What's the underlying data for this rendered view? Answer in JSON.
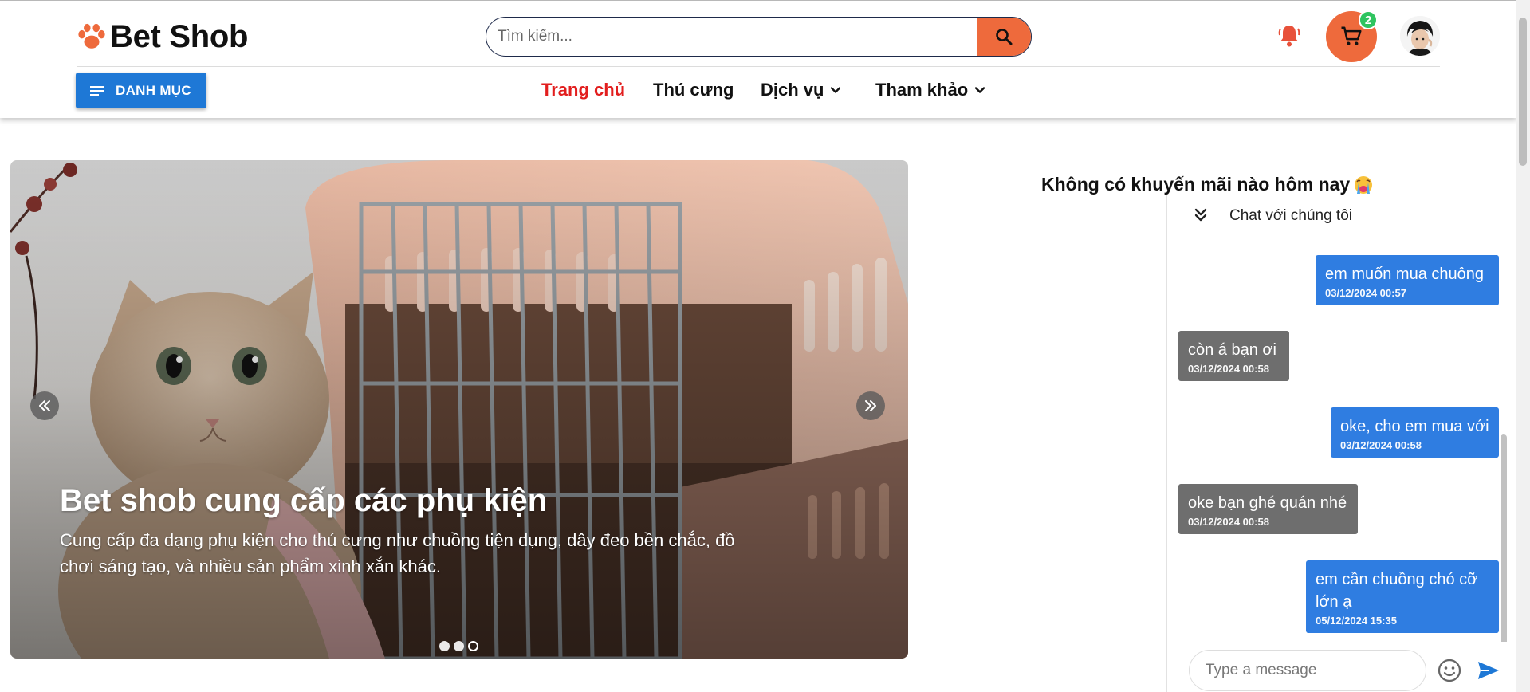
{
  "header": {
    "brand": "Bet Shob",
    "search_placeholder": "Tìm kiếm...",
    "cart_count": "2",
    "category_button": "DANH MỤC",
    "nav": [
      {
        "label": "Trang chủ",
        "active": true
      },
      {
        "label": "Thú cưng"
      },
      {
        "label": "Dịch vụ",
        "has_dropdown": true
      },
      {
        "label": "Tham khảo",
        "has_dropdown": true
      }
    ]
  },
  "carousel": {
    "title": "Bet shob cung cấp các phụ kiện",
    "description": "Cung cấp đa dạng phụ kiện cho thú cưng như chuồng tiện dụng, dây đeo bền chắc, đồ chơi sáng tạo, và nhiều sản phẩm xinh xắn khác.",
    "slide_count": 3,
    "active_slide": 3
  },
  "promo": {
    "text": "Không có khuyến mãi nào hôm nay"
  },
  "chat": {
    "title": "Chat với chúng tôi",
    "input_placeholder": "Type a message",
    "messages": [
      {
        "from": "me",
        "text": "em muốn mua chuông",
        "time": "03/12/2024 00:57"
      },
      {
        "from": "them",
        "text": "còn á bạn ơi",
        "time": "03/12/2024 00:58"
      },
      {
        "from": "me",
        "text": "oke, cho em mua với",
        "time": "03/12/2024 00:58"
      },
      {
        "from": "them",
        "text": "oke bạn ghé quán nhé",
        "time": "03/12/2024 00:58"
      },
      {
        "from": "me",
        "text": "em cần chuồng chó cỡ lớn ạ",
        "time": "05/12/2024 15:35"
      }
    ]
  },
  "colors": {
    "accent": "#ee6a3c",
    "primary_blue": "#1e78d6",
    "nav_active": "#e21e1e",
    "chat_me": "#2f7de1",
    "chat_them": "#6e6e6e",
    "badge_green": "#2fc45f"
  },
  "icons": {
    "logo": "paw-icon",
    "search": "search-icon",
    "notification": "bell-icon",
    "cart": "cart-icon",
    "menu": "menu-icon",
    "dropdown": "chevron-down-icon",
    "carousel_prev": "double-chevron-left-icon",
    "carousel_next": "double-chevron-right-icon",
    "chat_collapse": "double-chevron-down-icon",
    "emoji": "smiley-icon",
    "send": "send-icon",
    "promo_emoji": "crying-face-icon"
  }
}
